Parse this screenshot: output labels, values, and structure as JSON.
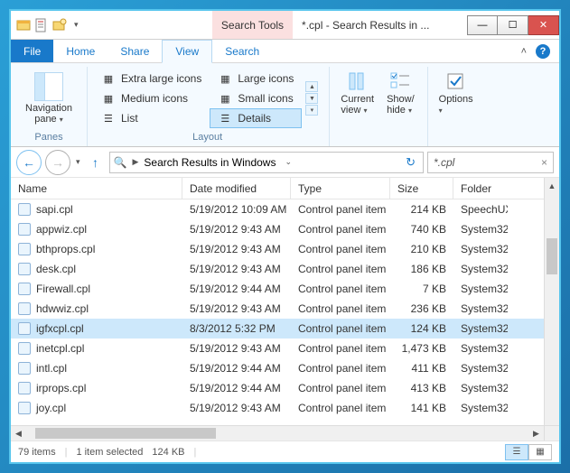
{
  "titlebar": {
    "context_tab": "Search Tools",
    "title": "*.cpl - Search Results in ..."
  },
  "menubar": {
    "file": "File",
    "tabs": [
      "Home",
      "Share",
      "View",
      "Search"
    ],
    "active_index": 2
  },
  "ribbon": {
    "panes_label": "Panes",
    "nav_pane": "Navigation\npane",
    "layout_label": "Layout",
    "layouts": {
      "xl": "Extra large icons",
      "lg": "Large icons",
      "md": "Medium icons",
      "sm": "Small icons",
      "list": "List",
      "details": "Details"
    },
    "current_view": "Current\nview",
    "show_hide": "Show/\nhide",
    "options": "Options"
  },
  "address": {
    "crumb": "Search Results in Windows"
  },
  "search": {
    "query": "*.cpl"
  },
  "columns": {
    "name": "Name",
    "date": "Date modified",
    "type": "Type",
    "size": "Size",
    "folder": "Folder"
  },
  "rows": [
    {
      "name": "sapi.cpl",
      "date": "5/19/2012 10:09 AM",
      "type": "Control panel item",
      "size": "214 KB",
      "folder": "SpeechUX"
    },
    {
      "name": "appwiz.cpl",
      "date": "5/19/2012 9:43 AM",
      "type": "Control panel item",
      "size": "740 KB",
      "folder": "System32"
    },
    {
      "name": "bthprops.cpl",
      "date": "5/19/2012 9:43 AM",
      "type": "Control panel item",
      "size": "210 KB",
      "folder": "System32"
    },
    {
      "name": "desk.cpl",
      "date": "5/19/2012 9:43 AM",
      "type": "Control panel item",
      "size": "186 KB",
      "folder": "System32"
    },
    {
      "name": "Firewall.cpl",
      "date": "5/19/2012 9:44 AM",
      "type": "Control panel item",
      "size": "7 KB",
      "folder": "System32"
    },
    {
      "name": "hdwwiz.cpl",
      "date": "5/19/2012 9:43 AM",
      "type": "Control panel item",
      "size": "236 KB",
      "folder": "System32"
    },
    {
      "name": "igfxcpl.cpl",
      "date": "8/3/2012 5:32 PM",
      "type": "Control panel item",
      "size": "124 KB",
      "folder": "System32"
    },
    {
      "name": "inetcpl.cpl",
      "date": "5/19/2012 9:43 AM",
      "type": "Control panel item",
      "size": "1,473 KB",
      "folder": "System32"
    },
    {
      "name": "intl.cpl",
      "date": "5/19/2012 9:44 AM",
      "type": "Control panel item",
      "size": "411 KB",
      "folder": "System32"
    },
    {
      "name": "irprops.cpl",
      "date": "5/19/2012 9:44 AM",
      "type": "Control panel item",
      "size": "413 KB",
      "folder": "System32"
    },
    {
      "name": "joy.cpl",
      "date": "5/19/2012 9:43 AM",
      "type": "Control panel item",
      "size": "141 KB",
      "folder": "System32"
    }
  ],
  "selected_index": 6,
  "status": {
    "count": "79 items",
    "selection": "1 item selected",
    "sel_size": "124 KB"
  }
}
